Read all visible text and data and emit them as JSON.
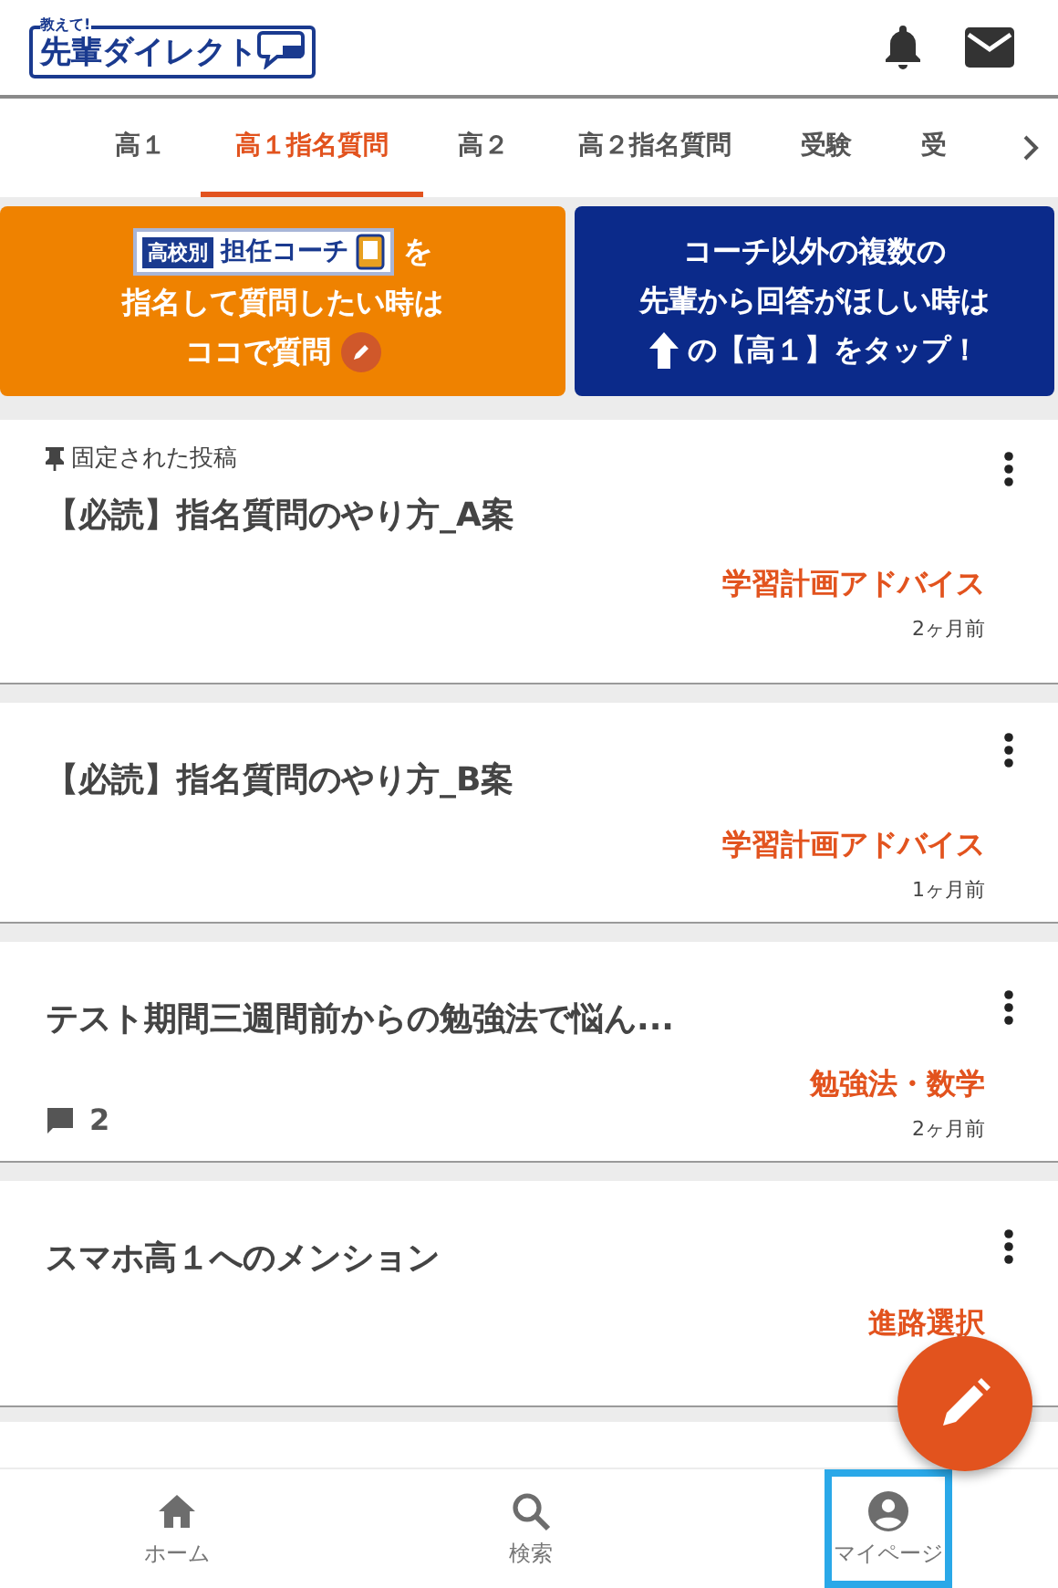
{
  "header": {
    "logo_small": "教えて!",
    "logo_text": "先輩ダイレクト"
  },
  "tabs": [
    {
      "label": "高１",
      "selected": false
    },
    {
      "label": "高１指名質問",
      "selected": true
    },
    {
      "label": "高２",
      "selected": false
    },
    {
      "label": "高２指名質問",
      "selected": false
    },
    {
      "label": "受験",
      "selected": false
    },
    {
      "label": "受",
      "selected": false
    }
  ],
  "banners": [
    {
      "kind": "designate",
      "badge": "高校別",
      "title": "担任コーチ",
      "lines": [
        "を",
        "指名して質問したい時は",
        "ココで質問"
      ]
    },
    {
      "kind": "others",
      "lines": [
        "コーチ以外の複数の",
        "先輩から回答がほしい時は",
        "の【高１】をタップ！"
      ]
    }
  ],
  "posts": [
    {
      "pinned": true,
      "pin_label": "固定された投稿",
      "title": "【必読】指名質問のやり方_A案",
      "tag": "学習計画アドバイス",
      "time": "2ヶ月前"
    },
    {
      "pinned": false,
      "title": "【必読】指名質問のやり方_B案",
      "tag": "学習計画アドバイス",
      "time": "1ヶ月前"
    },
    {
      "pinned": false,
      "title": "テスト期間三週間前からの勉強法で悩ん...",
      "tag": "勉強法・数学",
      "time": "2ヶ月前",
      "comments": "2"
    },
    {
      "pinned": false,
      "title": "スマホ高１へのメンション",
      "tag": "進路選択"
    }
  ],
  "bottom_nav": [
    {
      "kind": "home",
      "label": "ホーム",
      "highlighted": false
    },
    {
      "kind": "search",
      "label": "検索",
      "highlighted": false
    },
    {
      "kind": "mypage",
      "label": "マイページ",
      "highlighted": true
    }
  ]
}
